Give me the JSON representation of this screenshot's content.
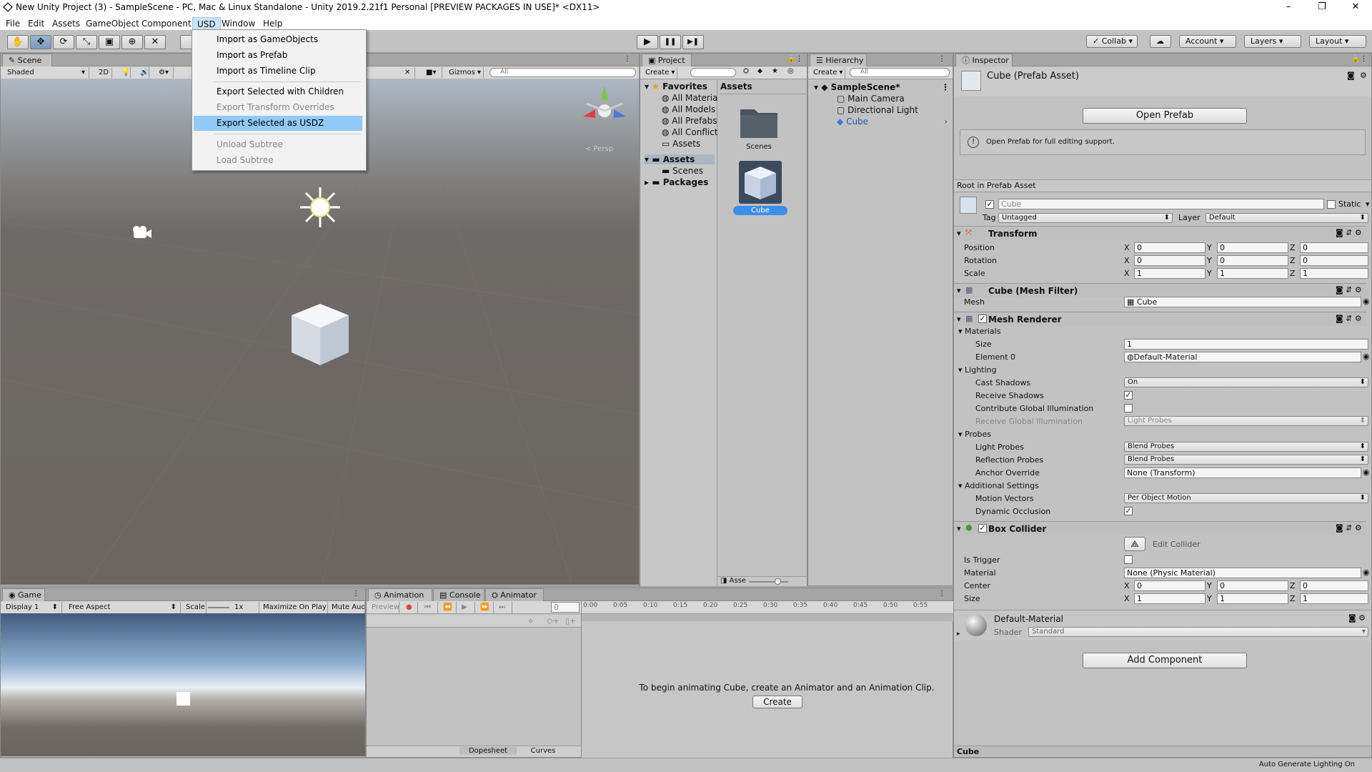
{
  "window": {
    "title": "New Unity Project (3) - SampleScene - PC, Mac & Linux Standalone - Unity 2019.2.21f1 Personal [PREVIEW PACKAGES IN USE]* <DX11>",
    "controls": [
      "–",
      "❐",
      "✕"
    ]
  },
  "menubar": [
    "File",
    "Edit",
    "Assets",
    "GameObject",
    "Component",
    "USD",
    "Window",
    "Help"
  ],
  "usd_menu": {
    "items": [
      {
        "label": "Import as GameObjects",
        "enabled": true
      },
      {
        "label": "Import as Prefab",
        "enabled": true
      },
      {
        "label": "Import as Timeline Clip",
        "enabled": true
      },
      {
        "label": "Export Selected with Children",
        "enabled": true
      },
      {
        "label": "Export Transform Overrides",
        "enabled": false
      },
      {
        "label": "Export Selected as USDZ",
        "enabled": true,
        "highlighted": true
      },
      {
        "label": "Unload Subtree",
        "enabled": false
      },
      {
        "label": "Load Subtree",
        "enabled": false
      }
    ]
  },
  "toolbar": {
    "tools": [
      "hand-tool-icon",
      "move-tool-icon",
      "rotate-tool-icon",
      "scale-tool-icon",
      "rect-tool-icon",
      "transform-tool-icon",
      "custom-tool-icon"
    ],
    "play": "▶",
    "pause": "❚❚",
    "step": "▶❚",
    "collab": "Collab",
    "account": "Account",
    "layers": "Layers",
    "layout": "Layout"
  },
  "scene": {
    "tab": "Scene",
    "shading": "Shaded",
    "mode2d": "2D",
    "gizmos": "Gizmos",
    "search_placeholder": "All",
    "persp_label": "< Persp"
  },
  "game": {
    "tab": "Game",
    "display": "Display 1",
    "aspect": "Free Aspect",
    "scale_label": "Scale",
    "scale_value": "1x",
    "maximize": "Maximize On Play",
    "mute": "Mute Aud"
  },
  "animation": {
    "tabs": [
      "Animation",
      "Console",
      "Animator"
    ],
    "preview": "Preview",
    "frame": "0",
    "timeline_ticks": [
      "0:00",
      "0:05",
      "0:10",
      "0:15",
      "0:20",
      "0:25",
      "0:30",
      "0:35",
      "0:40",
      "0:45",
      "0:50",
      "0:55"
    ],
    "message": "To begin animating Cube, create an Animator and an Animation Clip.",
    "create_button": "Create",
    "bottom_tabs": [
      "Dopesheet",
      "Curves"
    ]
  },
  "project": {
    "tab": "Project",
    "create": "Create",
    "favorites_label": "Favorites",
    "favorites": [
      "All Materia",
      "All Models",
      "All Prefabs",
      "All Conflict",
      "Assets"
    ],
    "assets_label": "Assets",
    "assets_children": [
      "Scenes"
    ],
    "packages_label": "Packages",
    "grid_title": "Assets",
    "grid_items": [
      "Scenes",
      "Cube"
    ],
    "footer_label": "Asse"
  },
  "hierarchy": {
    "tab": "Hierarchy",
    "create": "Create",
    "search_placeholder": "All",
    "scene": "SampleScene*",
    "items": [
      "Main Camera",
      "Directional Light",
      "Cube"
    ]
  },
  "inspector": {
    "tab": "Inspector",
    "title": "Cube (Prefab Asset)",
    "open_prefab": "Open Prefab",
    "info": "Open Prefab for full editing support.",
    "root_label": "Root in Prefab Asset",
    "object_name": "Cube",
    "static_label": "Static",
    "tag_label": "Tag",
    "tag_value": "Untagged",
    "layer_label": "Layer",
    "layer_value": "Default",
    "transform": {
      "title": "Transform",
      "rows": [
        {
          "label": "Position",
          "x": "0",
          "y": "0",
          "z": "0"
        },
        {
          "label": "Rotation",
          "x": "0",
          "y": "0",
          "z": "0"
        },
        {
          "label": "Scale",
          "x": "1",
          "y": "1",
          "z": "1"
        }
      ]
    },
    "mesh_filter": {
      "title": "Cube (Mesh Filter)",
      "mesh_label": "Mesh",
      "mesh_value": "Cube"
    },
    "mesh_renderer": {
      "title": "Mesh Renderer",
      "materials": "Materials",
      "size_label": "Size",
      "size_value": "1",
      "element0_label": "Element 0",
      "element0_value": "Default-Material",
      "lighting": "Lighting",
      "cast_shadows_label": "Cast Shadows",
      "cast_shadows_value": "On",
      "receive_shadows_label": "Receive Shadows",
      "contribute_gi_label": "Contribute Global Illumination",
      "receive_gi_label": "Receive Global Illumination",
      "receive_gi_value": "Light Probes",
      "probes": "Probes",
      "light_probes_label": "Light Probes",
      "light_probes_value": "Blend Probes",
      "reflection_probes_label": "Reflection Probes",
      "reflection_probes_value": "Blend Probes",
      "anchor_label": "Anchor Override",
      "anchor_value": "None (Transform)",
      "additional": "Additional Settings",
      "motion_label": "Motion Vectors",
      "motion_value": "Per Object Motion",
      "dynamic_occ_label": "Dynamic Occlusion"
    },
    "box_collider": {
      "title": "Box Collider",
      "edit_collider": "Edit Collider",
      "is_trigger_label": "Is Trigger",
      "material_label": "Material",
      "material_value": "None (Physic Material)",
      "center_label": "Center",
      "center": {
        "x": "0",
        "y": "0",
        "z": "0"
      },
      "size_label": "Size",
      "size": {
        "x": "1",
        "y": "1",
        "z": "1"
      }
    },
    "material": {
      "name": "Default-Material",
      "shader_label": "Shader",
      "shader_value": "Standard"
    },
    "add_component": "Add Component",
    "preview_label": "Cube"
  },
  "statusbar": {
    "right": "Auto Generate Lighting On"
  }
}
